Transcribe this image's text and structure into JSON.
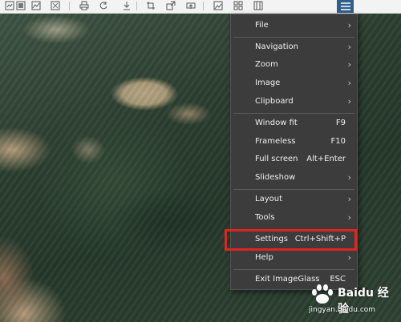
{
  "toolbar": {
    "icons": [
      "open-file-icon",
      "image-info-icon",
      "gallery-icon",
      "print-icon",
      "rotate-icon",
      "download-icon",
      "crop-icon",
      "resize-icon",
      "upload-icon",
      "image-icon",
      "thumbnails-grid-icon",
      "checkerboard-icon",
      "hamburger-menu-icon"
    ]
  },
  "menu": {
    "items": [
      {
        "label": "File",
        "shortcut": "",
        "submenu": true
      },
      {
        "label": "Navigation",
        "shortcut": "",
        "submenu": true
      },
      {
        "label": "Zoom",
        "shortcut": "",
        "submenu": true
      },
      {
        "label": "Image",
        "shortcut": "",
        "submenu": true
      },
      {
        "label": "Clipboard",
        "shortcut": "",
        "submenu": true
      },
      {
        "label": "Window fit",
        "shortcut": "F9",
        "submenu": false
      },
      {
        "label": "Frameless",
        "shortcut": "F10",
        "submenu": false
      },
      {
        "label": "Full screen",
        "shortcut": "Alt+Enter",
        "submenu": false
      },
      {
        "label": "Slideshow",
        "shortcut": "",
        "submenu": true
      },
      {
        "label": "Layout",
        "shortcut": "",
        "submenu": true
      },
      {
        "label": "Tools",
        "shortcut": "",
        "submenu": true
      },
      {
        "label": "Settings",
        "shortcut": "Ctrl+Shift+P",
        "submenu": false
      },
      {
        "label": "Help",
        "shortcut": "",
        "submenu": true
      },
      {
        "label": "Exit ImageGlass",
        "shortcut": "ESC",
        "submenu": false
      }
    ],
    "arrow_glyph": "›",
    "highlighted_item": "Settings",
    "highlight_color": "#e0251f",
    "accent_color": "#2f5f8d"
  },
  "watermark": {
    "title": "Baidu 经验",
    "url": "jingyan.baidu.com"
  }
}
